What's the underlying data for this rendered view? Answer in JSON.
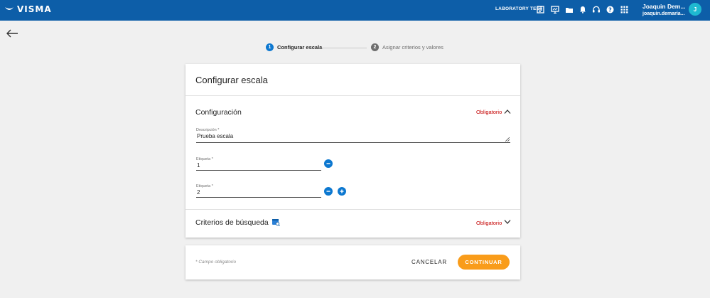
{
  "header": {
    "brand": "VISMA",
    "environment": "LABORATORY TEST",
    "user_name": "Joaquin Dem...",
    "user_email": "joaquin.demaria...",
    "avatar_initial": "J"
  },
  "stepper": {
    "steps": [
      {
        "number": "1",
        "label": "Configurar escala",
        "active": true
      },
      {
        "number": "2",
        "label": "Asignar criterios y valores",
        "active": false
      }
    ]
  },
  "card": {
    "title": "Configurar escala",
    "config_section": {
      "title": "Configuración",
      "required_label": "Obligatorio",
      "description": {
        "label": "Descripción *",
        "value": "Prueba escala"
      },
      "orders": [
        {
          "label": "Etiqueta *",
          "value": "1"
        },
        {
          "label": "Etiqueta *",
          "value": "2"
        }
      ]
    },
    "criteria_section": {
      "title": "Criterios de búsqueda",
      "required_label": "Obligatorio"
    }
  },
  "footer": {
    "required_hint": "* Campo obligatorio",
    "cancel_label": "CANCELAR",
    "continue_label": "CONTINUAR"
  },
  "colors": {
    "header_bg": "#0d5ea8",
    "primary": "#0d78d0",
    "accent_orange": "#f99c1a",
    "required_red": "#c40000",
    "avatar": "#1eb9d1"
  },
  "icons": {
    "topbar": [
      "report-icon",
      "presentation-icon",
      "folder-icon",
      "bell-icon",
      "headset-icon",
      "help-icon",
      "apps-grid-icon"
    ]
  }
}
